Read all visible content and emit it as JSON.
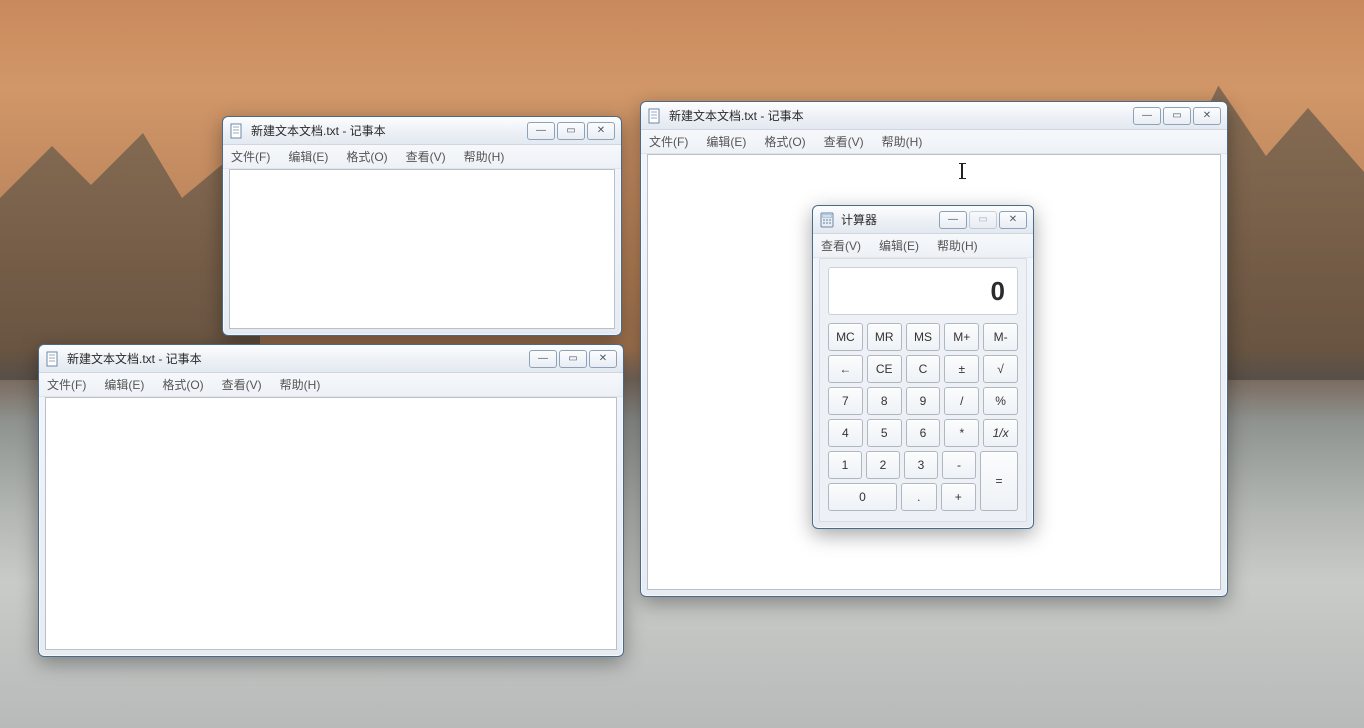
{
  "notepad_menus": [
    "文件(F)",
    "编辑(E)",
    "格式(O)",
    "查看(V)",
    "帮助(H)"
  ],
  "calc_menus": [
    "查看(V)",
    "编辑(E)",
    "帮助(H)"
  ],
  "notepad1": {
    "title": "新建文本文档.txt - 记事本",
    "content": ""
  },
  "notepad2": {
    "title": "新建文本文档.txt - 记事本",
    "content": ""
  },
  "notepad3": {
    "title": "新建文本文档.txt - 记事本",
    "content": ""
  },
  "calculator": {
    "title": "计算器",
    "display": "0",
    "mem_row": [
      "MC",
      "MR",
      "MS",
      "M+",
      "M-"
    ],
    "row1": [
      "←",
      "CE",
      "C",
      "±",
      "√"
    ],
    "row2": [
      "7",
      "8",
      "9",
      "/",
      "%"
    ],
    "row3": [
      "4",
      "5",
      "6",
      "*",
      "1/x"
    ],
    "row4_left": [
      "1",
      "2",
      "3",
      "-"
    ],
    "row5_left": [
      "0",
      ".",
      "+"
    ],
    "equals": "="
  },
  "win_controls": {
    "min": "—",
    "max": "▭",
    "close": "✕"
  }
}
